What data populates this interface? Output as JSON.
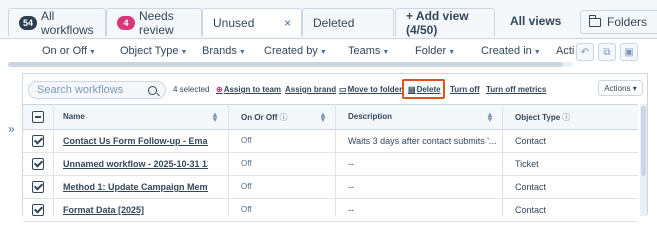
{
  "tabs": [
    {
      "badge": "54",
      "label": "All workflows"
    },
    {
      "badge": "4",
      "label": "Needs review"
    },
    {
      "label": "Unused",
      "close": "×"
    },
    {
      "label": "Deleted"
    }
  ],
  "add_view": "+ Add view (4/50)",
  "all_views": "All views",
  "folders": "Folders",
  "filters": [
    "On or Off",
    "Object Type",
    "Brands",
    "Created by",
    "Teams",
    "Folder",
    "Created in",
    "Acti"
  ],
  "filter_buttons": [
    "↶",
    "⧉",
    "▣"
  ],
  "expand_toggle": "»",
  "toolbar": {
    "search_placeholder": "Search workflows",
    "selected": "4 selected",
    "assign_team": "Assign to team",
    "assign_brand": "Assign brand",
    "move_folder": "Move to folder",
    "delete": "Delete",
    "turn_off": "Turn off",
    "turn_off_metrics": "Turn off metrics",
    "actions": "Actions ▾"
  },
  "table": {
    "headers": {
      "name": "Name",
      "on_off": "On Or Off",
      "description": "Description",
      "object_type": "Object Type"
    },
    "rows": [
      {
        "name": "Contact Us Form Follow-up - Email A",
        "on_off": "Off",
        "description": "Waits 3 days after contact submits '...",
        "object_type": "Contact"
      },
      {
        "name": "Unnamed workflow - 2025-10-31 13:23",
        "on_off": "Off",
        "description": "--",
        "object_type": "Ticket"
      },
      {
        "name": "Method 1: Update Campaign Member St",
        "on_off": "Off",
        "description": "--",
        "object_type": "Contact"
      },
      {
        "name": "Format Data [2025]",
        "on_off": "Off",
        "description": "--",
        "object_type": "Contact"
      }
    ]
  },
  "colors": {
    "accent_pink": "#d6397a",
    "highlight_orange": "#e0531f",
    "text": "#33475b"
  }
}
